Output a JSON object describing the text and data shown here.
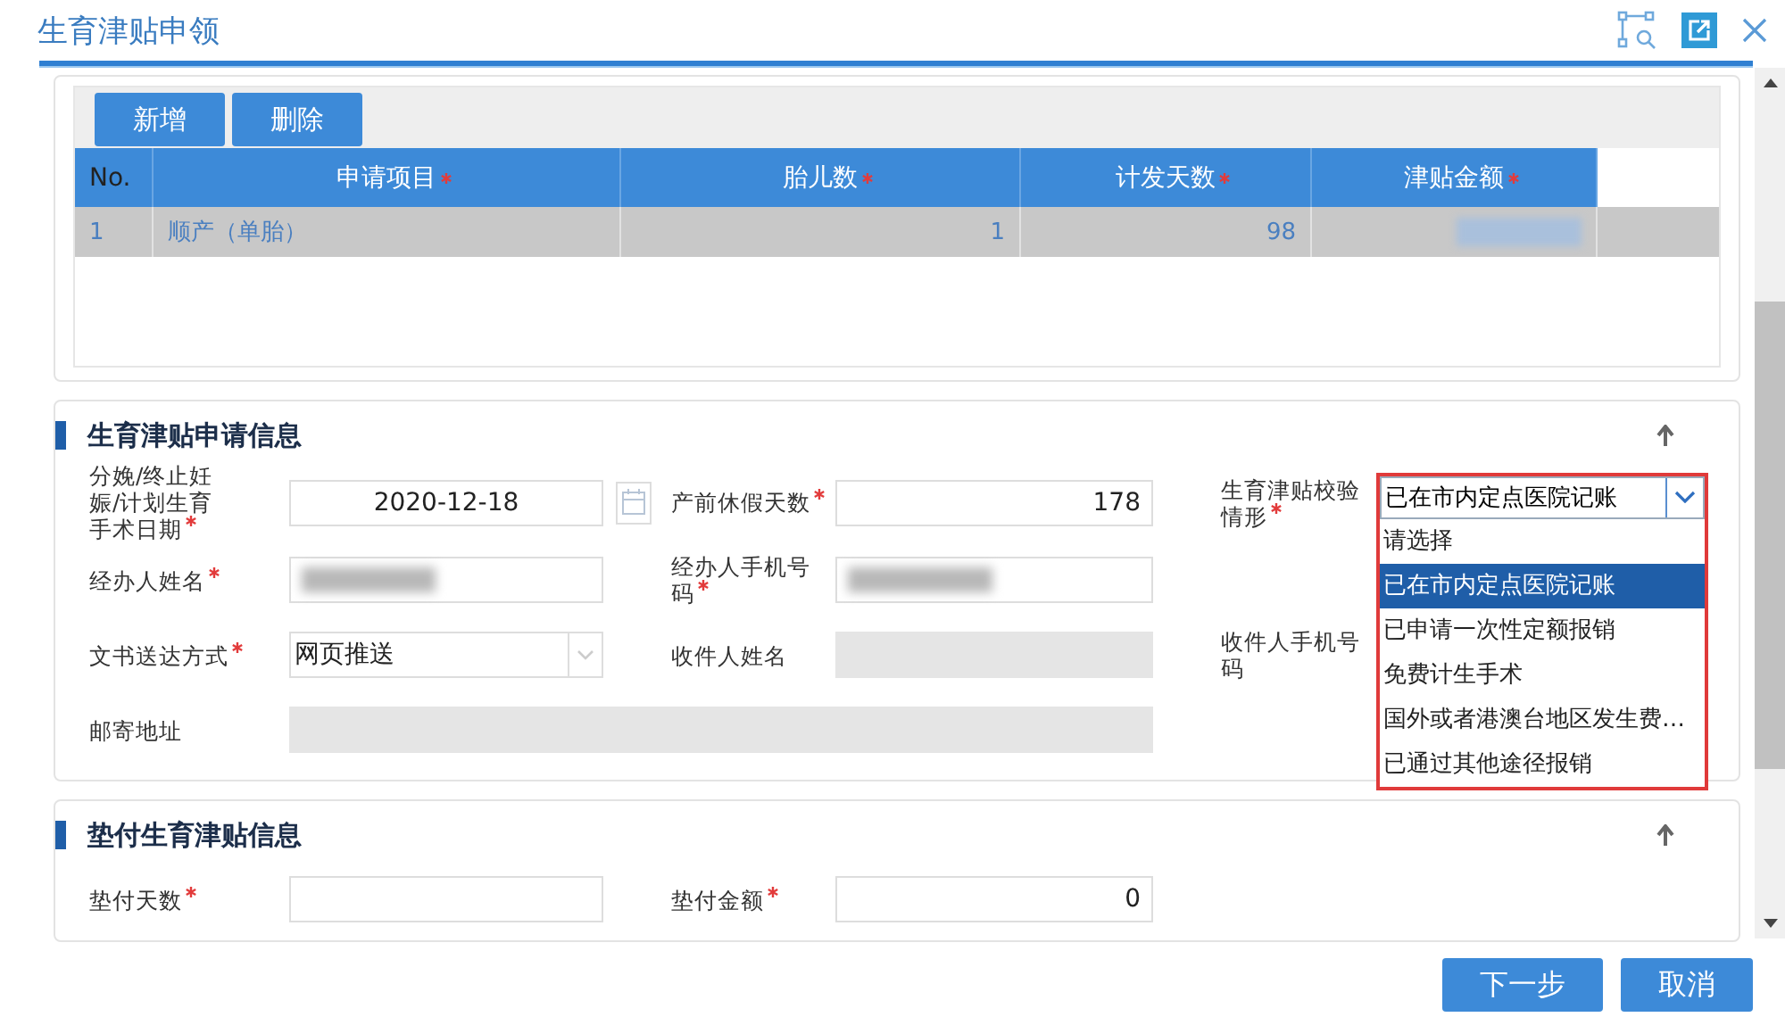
{
  "window": {
    "title": "生育津贴申领"
  },
  "toolbar": [
    {
      "label": "新增"
    },
    {
      "label": "删除"
    }
  ],
  "table": {
    "columns": [
      {
        "label": "No.",
        "required": false
      },
      {
        "label": "申请项目",
        "required": true
      },
      {
        "label": "胎儿数",
        "required": true
      },
      {
        "label": "计发天数",
        "required": true
      },
      {
        "label": "津贴金额",
        "required": true
      }
    ],
    "rows": [
      {
        "selected": true,
        "cells": [
          {
            "kind": "text",
            "text": "1"
          },
          {
            "kind": "text",
            "text": "顺产（单胎）"
          },
          {
            "kind": "number",
            "text": "1"
          },
          {
            "kind": "number",
            "text": "98"
          },
          {
            "kind": "blurred"
          }
        ]
      }
    ]
  },
  "sections": [
    {
      "title": "生育津贴申请信息",
      "rows": [
        [
          {
            "label": "分娩/终止妊娠/计划生育手术日期",
            "required": true,
            "kind": "date",
            "value": "2020-12-18"
          },
          {
            "label": "产前休假天数",
            "required": true,
            "kind": "number",
            "value": "178"
          },
          {
            "label": "生育津贴校验情形",
            "required": true,
            "kind": "dropdown",
            "value": "已在市内定点医院记账",
            "options": [
              {
                "label": "请选择",
                "selected": false
              },
              {
                "label": "已在市内定点医院记账",
                "selected": true
              },
              {
                "label": "已申请一次性定额报销",
                "selected": false
              },
              {
                "label": "免费计生手术",
                "selected": false
              },
              {
                "label": "国外或者港澳台地区发生费…",
                "selected": false
              },
              {
                "label": "已通过其他途径报销",
                "selected": false
              }
            ]
          }
        ],
        [
          {
            "label": "经办人姓名",
            "required": true,
            "kind": "blurred"
          },
          {
            "label": "经办人手机号码",
            "required": true,
            "kind": "blurred"
          }
        ],
        [
          {
            "label": "文书送达方式",
            "required": true,
            "kind": "select",
            "value": "网页推送"
          },
          {
            "label": "收件人姓名",
            "required": false,
            "kind": "readonly"
          },
          {
            "label": "收件人手机号码",
            "required": false,
            "kind": "covered"
          }
        ],
        [
          {
            "label": "邮寄地址",
            "required": false,
            "kind": "wide"
          }
        ]
      ]
    },
    {
      "title": "垫付生育津贴信息",
      "rows": [
        [
          {
            "label": "垫付天数",
            "required": true,
            "kind": "number"
          },
          {
            "label": "垫付金额",
            "required": true,
            "kind": "number",
            "value": "0"
          }
        ]
      ]
    }
  ],
  "footer": [
    {
      "label": "下一步"
    },
    {
      "label": "取消"
    }
  ]
}
